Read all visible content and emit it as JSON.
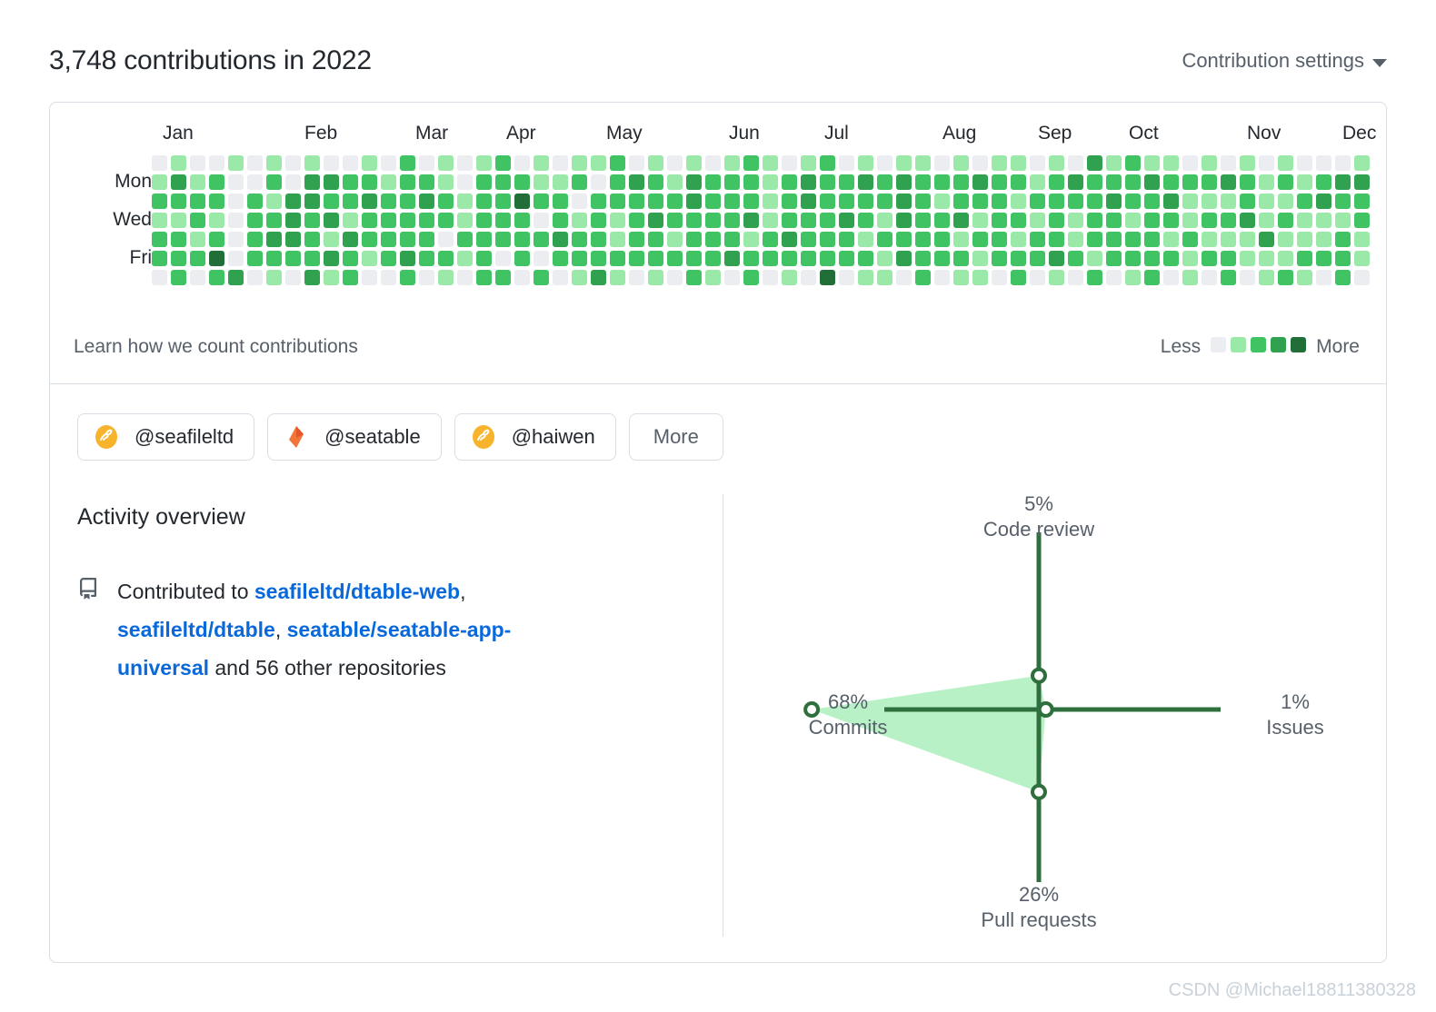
{
  "header": {
    "title": "3,748 contributions in 2022",
    "settings_label": "Contribution settings",
    "caret_icon": "chevron-down-icon"
  },
  "calendar": {
    "months": [
      "Jan",
      "Feb",
      "Mar",
      "Apr",
      "May",
      "Jun",
      "Jul",
      "Aug",
      "Sep",
      "Oct",
      "Nov",
      "Dec"
    ],
    "month_positions": [
      12,
      168,
      290,
      390,
      500,
      635,
      740,
      870,
      975,
      1075,
      1205,
      1310
    ],
    "day_labels": [
      "Mon",
      "Wed",
      "Fri"
    ],
    "day_label_rows": [
      1,
      3,
      5
    ],
    "learn_link": "Learn how we count contributions",
    "legend": {
      "less_label": "Less",
      "more_label": "More",
      "colors": [
        "#ebedf0",
        "#9be9a8",
        "#40c463",
        "#30a14e",
        "#216e39"
      ]
    },
    "cell_size": 17,
    "cell_step": 21,
    "rows": 7,
    "columns": 64,
    "levels": [
      [
        0,
        1,
        0,
        0,
        1,
        0,
        1,
        0,
        1,
        0,
        0,
        1,
        0,
        2,
        0,
        1,
        0,
        1,
        2,
        0,
        1,
        0,
        1,
        1,
        2,
        0,
        1,
        0,
        1,
        0,
        1,
        2,
        1,
        0,
        1,
        2,
        0,
        1,
        0,
        1,
        1,
        0,
        1,
        0,
        1,
        1,
        0,
        1,
        0,
        3,
        1,
        2,
        1,
        1,
        0,
        1,
        0,
        1,
        0,
        1,
        0,
        0,
        0,
        1
      ],
      [
        1,
        3,
        1,
        2,
        0,
        0,
        2,
        0,
        3,
        3,
        2,
        2,
        1,
        2,
        2,
        1,
        0,
        2,
        2,
        2,
        1,
        1,
        2,
        0,
        2,
        3,
        2,
        1,
        3,
        2,
        2,
        2,
        1,
        2,
        3,
        2,
        2,
        3,
        2,
        3,
        2,
        2,
        2,
        3,
        2,
        2,
        1,
        2,
        3,
        2,
        2,
        2,
        3,
        2,
        2,
        2,
        3,
        2,
        1,
        2,
        1,
        2,
        3,
        3
      ],
      [
        2,
        2,
        2,
        2,
        0,
        2,
        1,
        3,
        3,
        2,
        2,
        3,
        2,
        2,
        3,
        2,
        1,
        2,
        2,
        4,
        2,
        2,
        0,
        2,
        2,
        2,
        2,
        2,
        3,
        2,
        2,
        2,
        1,
        2,
        3,
        2,
        2,
        2,
        2,
        3,
        2,
        1,
        2,
        2,
        2,
        1,
        2,
        2,
        2,
        2,
        3,
        2,
        2,
        3,
        1,
        1,
        1,
        2,
        1,
        1,
        2,
        3,
        2,
        2
      ],
      [
        1,
        1,
        2,
        1,
        0,
        2,
        2,
        3,
        2,
        3,
        1,
        2,
        2,
        2,
        2,
        2,
        1,
        2,
        2,
        2,
        0,
        2,
        1,
        2,
        1,
        2,
        3,
        2,
        2,
        2,
        2,
        3,
        1,
        2,
        2,
        2,
        3,
        2,
        1,
        3,
        2,
        2,
        3,
        1,
        2,
        2,
        1,
        2,
        1,
        2,
        2,
        1,
        2,
        2,
        1,
        2,
        2,
        3,
        1,
        2,
        1,
        1,
        1,
        2
      ],
      [
        2,
        2,
        1,
        2,
        0,
        2,
        3,
        3,
        2,
        1,
        3,
        2,
        2,
        2,
        2,
        0,
        2,
        2,
        2,
        2,
        2,
        3,
        2,
        2,
        1,
        2,
        2,
        1,
        2,
        2,
        2,
        1,
        2,
        3,
        2,
        2,
        2,
        1,
        2,
        2,
        2,
        2,
        1,
        2,
        2,
        1,
        2,
        2,
        1,
        2,
        2,
        2,
        2,
        1,
        2,
        1,
        1,
        1,
        3,
        1,
        1,
        1,
        2,
        1
      ],
      [
        2,
        2,
        2,
        4,
        0,
        2,
        2,
        2,
        2,
        3,
        2,
        1,
        2,
        3,
        2,
        2,
        1,
        2,
        0,
        2,
        0,
        2,
        2,
        2,
        2,
        2,
        2,
        2,
        2,
        2,
        3,
        2,
        2,
        2,
        2,
        2,
        2,
        2,
        1,
        3,
        2,
        2,
        2,
        1,
        2,
        2,
        2,
        3,
        2,
        1,
        2,
        2,
        2,
        2,
        1,
        2,
        2,
        1,
        1,
        1,
        2,
        2,
        2,
        1
      ],
      [
        0,
        2,
        0,
        2,
        3,
        0,
        1,
        0,
        3,
        1,
        2,
        0,
        0,
        2,
        0,
        1,
        0,
        2,
        2,
        0,
        2,
        0,
        1,
        3,
        1,
        0,
        1,
        0,
        2,
        1,
        0,
        2,
        0,
        1,
        0,
        4,
        0,
        1,
        1,
        0,
        2,
        0,
        1,
        1,
        0,
        2,
        0,
        1,
        0,
        2,
        0,
        1,
        2,
        0,
        1,
        0,
        2,
        0,
        1,
        2,
        1,
        0,
        2,
        0
      ]
    ]
  },
  "orgs": {
    "chips": [
      {
        "name": "@seafileltd",
        "avatar_icon": "seafile-avatar-icon",
        "avatar_type": "seafile"
      },
      {
        "name": "@seatable",
        "avatar_icon": "seatable-avatar-icon",
        "avatar_type": "seatable"
      },
      {
        "name": "@haiwen",
        "avatar_icon": "seafile-avatar-icon",
        "avatar_type": "seafile"
      }
    ],
    "more_label": "More"
  },
  "activity": {
    "title": "Activity overview",
    "icon": "repo-icon",
    "prefix": "Contributed to ",
    "repos": [
      "seafileltd/dtable-web",
      "seafileltd/dtable",
      "seatable/seatable-app-universal"
    ],
    "suffix": "and 56 other repositories"
  },
  "chart_data": {
    "type": "radar",
    "title": "",
    "axes": [
      {
        "name": "Code review",
        "value": 5,
        "label": "5%",
        "position": "top"
      },
      {
        "name": "Issues",
        "value": 1,
        "label": "1%",
        "position": "right"
      },
      {
        "name": "Pull requests",
        "value": 26,
        "label": "26%",
        "position": "bottom"
      },
      {
        "name": "Commits",
        "value": 68,
        "label": "68%",
        "position": "left"
      }
    ],
    "max": 68,
    "fill_color": "#aceebb",
    "stroke_color": "#2f6f3e",
    "point_color": "#ffffff",
    "legend": "none",
    "grid": false
  },
  "watermark": "CSDN @Michael18811380328"
}
